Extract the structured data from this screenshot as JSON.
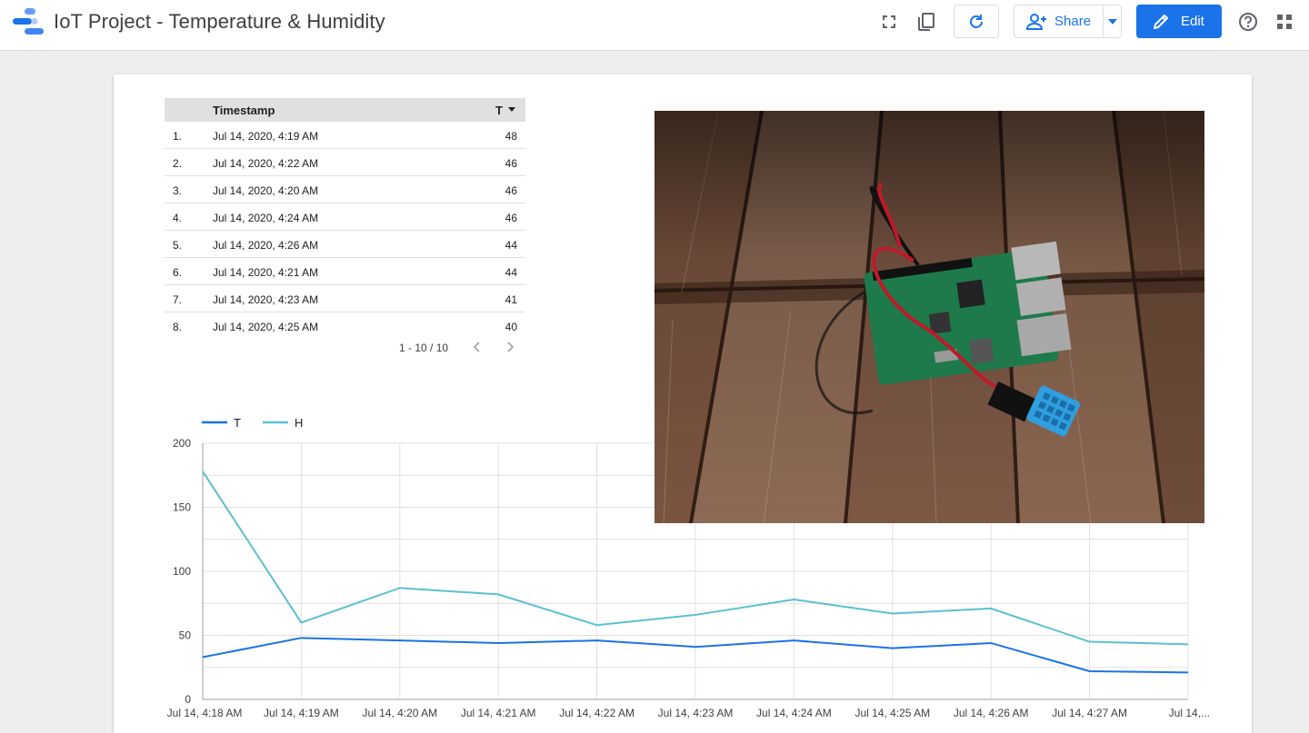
{
  "header": {
    "title": "IoT Project - Temperature & Humidity",
    "share_label": "Share",
    "edit_label": "Edit",
    "icons": [
      "fullscreen-icon",
      "copy-icon",
      "refresh-icon",
      "add-person-icon",
      "dropdown-arrow-icon",
      "pencil-icon",
      "help-icon",
      "apps-grid-icon"
    ]
  },
  "table": {
    "headers": [
      "Timestamp",
      "T"
    ],
    "rows": [
      {
        "idx": "1.",
        "timestamp": "Jul 14, 2020, 4:19 AM",
        "t": "48"
      },
      {
        "idx": "2.",
        "timestamp": "Jul 14, 2020, 4:22 AM",
        "t": "46"
      },
      {
        "idx": "3.",
        "timestamp": "Jul 14, 2020, 4:20 AM",
        "t": "46"
      },
      {
        "idx": "4.",
        "timestamp": "Jul 14, 2020, 4:24 AM",
        "t": "46"
      },
      {
        "idx": "5.",
        "timestamp": "Jul 14, 2020, 4:26 AM",
        "t": "44"
      },
      {
        "idx": "6.",
        "timestamp": "Jul 14, 2020, 4:21 AM",
        "t": "44"
      },
      {
        "idx": "7.",
        "timestamp": "Jul 14, 2020, 4:23 AM",
        "t": "41"
      },
      {
        "idx": "8.",
        "timestamp": "Jul 14, 2020, 4:25 AM",
        "t": "40"
      }
    ],
    "pager": "1 - 10 / 10"
  },
  "chart_data": {
    "type": "line",
    "x": [
      "Jul 14, 4:18 AM",
      "Jul 14, 4:19 AM",
      "Jul 14, 4:20 AM",
      "Jul 14, 4:21 AM",
      "Jul 14, 4:22 AM",
      "Jul 14, 4:23 AM",
      "Jul 14, 4:24 AM",
      "Jul 14, 4:25 AM",
      "Jul 14, 4:26 AM",
      "Jul 14, 4:27 AM",
      "Jul 14,..."
    ],
    "series": [
      {
        "name": "T",
        "color": "#1a73e8",
        "values": [
          33,
          48,
          46,
          44,
          46,
          41,
          46,
          40,
          44,
          22,
          21
        ]
      },
      {
        "name": "H",
        "color": "#5bc0d0",
        "values": [
          178,
          60,
          87,
          82,
          58,
          66,
          78,
          67,
          71,
          45,
          43
        ]
      }
    ],
    "yticks": [
      0,
      50,
      100,
      150,
      200
    ],
    "ylim": [
      0,
      200
    ],
    "legend": "top-left",
    "grid": true
  },
  "image": {
    "subject": "raspberry-pi-board-with-dht11-sensor-on-wooden-deck"
  }
}
